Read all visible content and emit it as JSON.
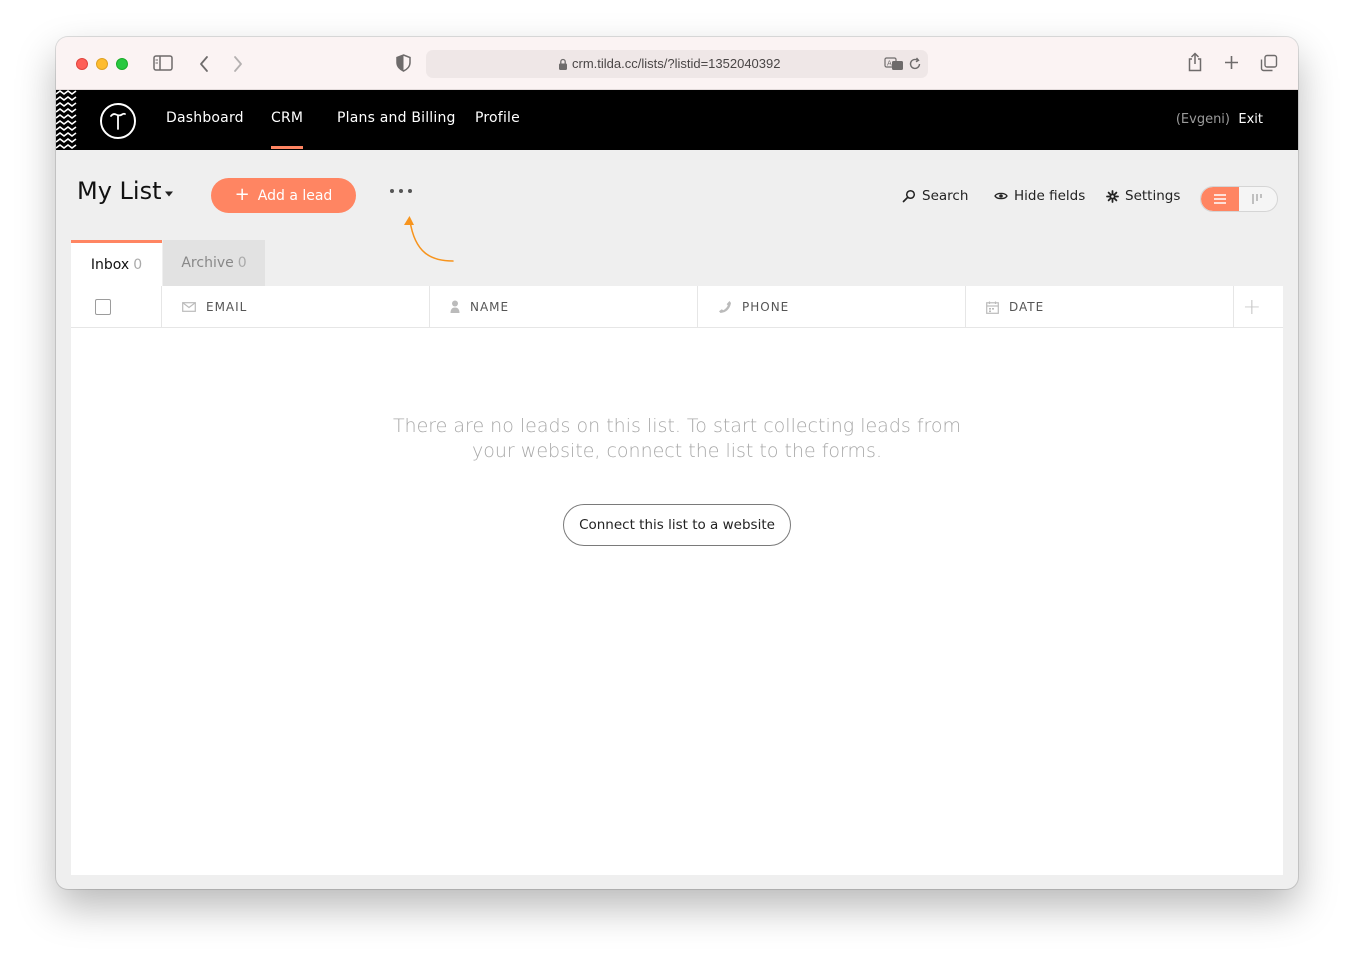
{
  "browser": {
    "url": "crm.tilda.cc/lists/?listid=1352040392"
  },
  "header": {
    "nav": [
      {
        "label": "Dashboard"
      },
      {
        "label": "CRM"
      },
      {
        "label": "Plans and Billing"
      },
      {
        "label": "Profile"
      }
    ],
    "active_nav": "CRM",
    "user": "(Evgeni)",
    "exit_label": "Exit"
  },
  "list": {
    "title": "My List",
    "add_lead_label": "Add a lead",
    "tools": {
      "search": "Search",
      "hide_fields": "Hide fields",
      "settings": "Settings"
    },
    "tabs": [
      {
        "label": "Inbox",
        "count": "0"
      },
      {
        "label": "Archive",
        "count": "0"
      }
    ],
    "columns": [
      "EMAIL",
      "NAME",
      "PHONE",
      "DATE"
    ],
    "empty_message": "There are no leads on this list. To start collecting leads from your website, connect the list to the forms.",
    "connect_label": "Connect this list to a website"
  },
  "colors": {
    "accent": "#ff8562",
    "header_bg": "#000000",
    "arrow": "#f7941d"
  }
}
